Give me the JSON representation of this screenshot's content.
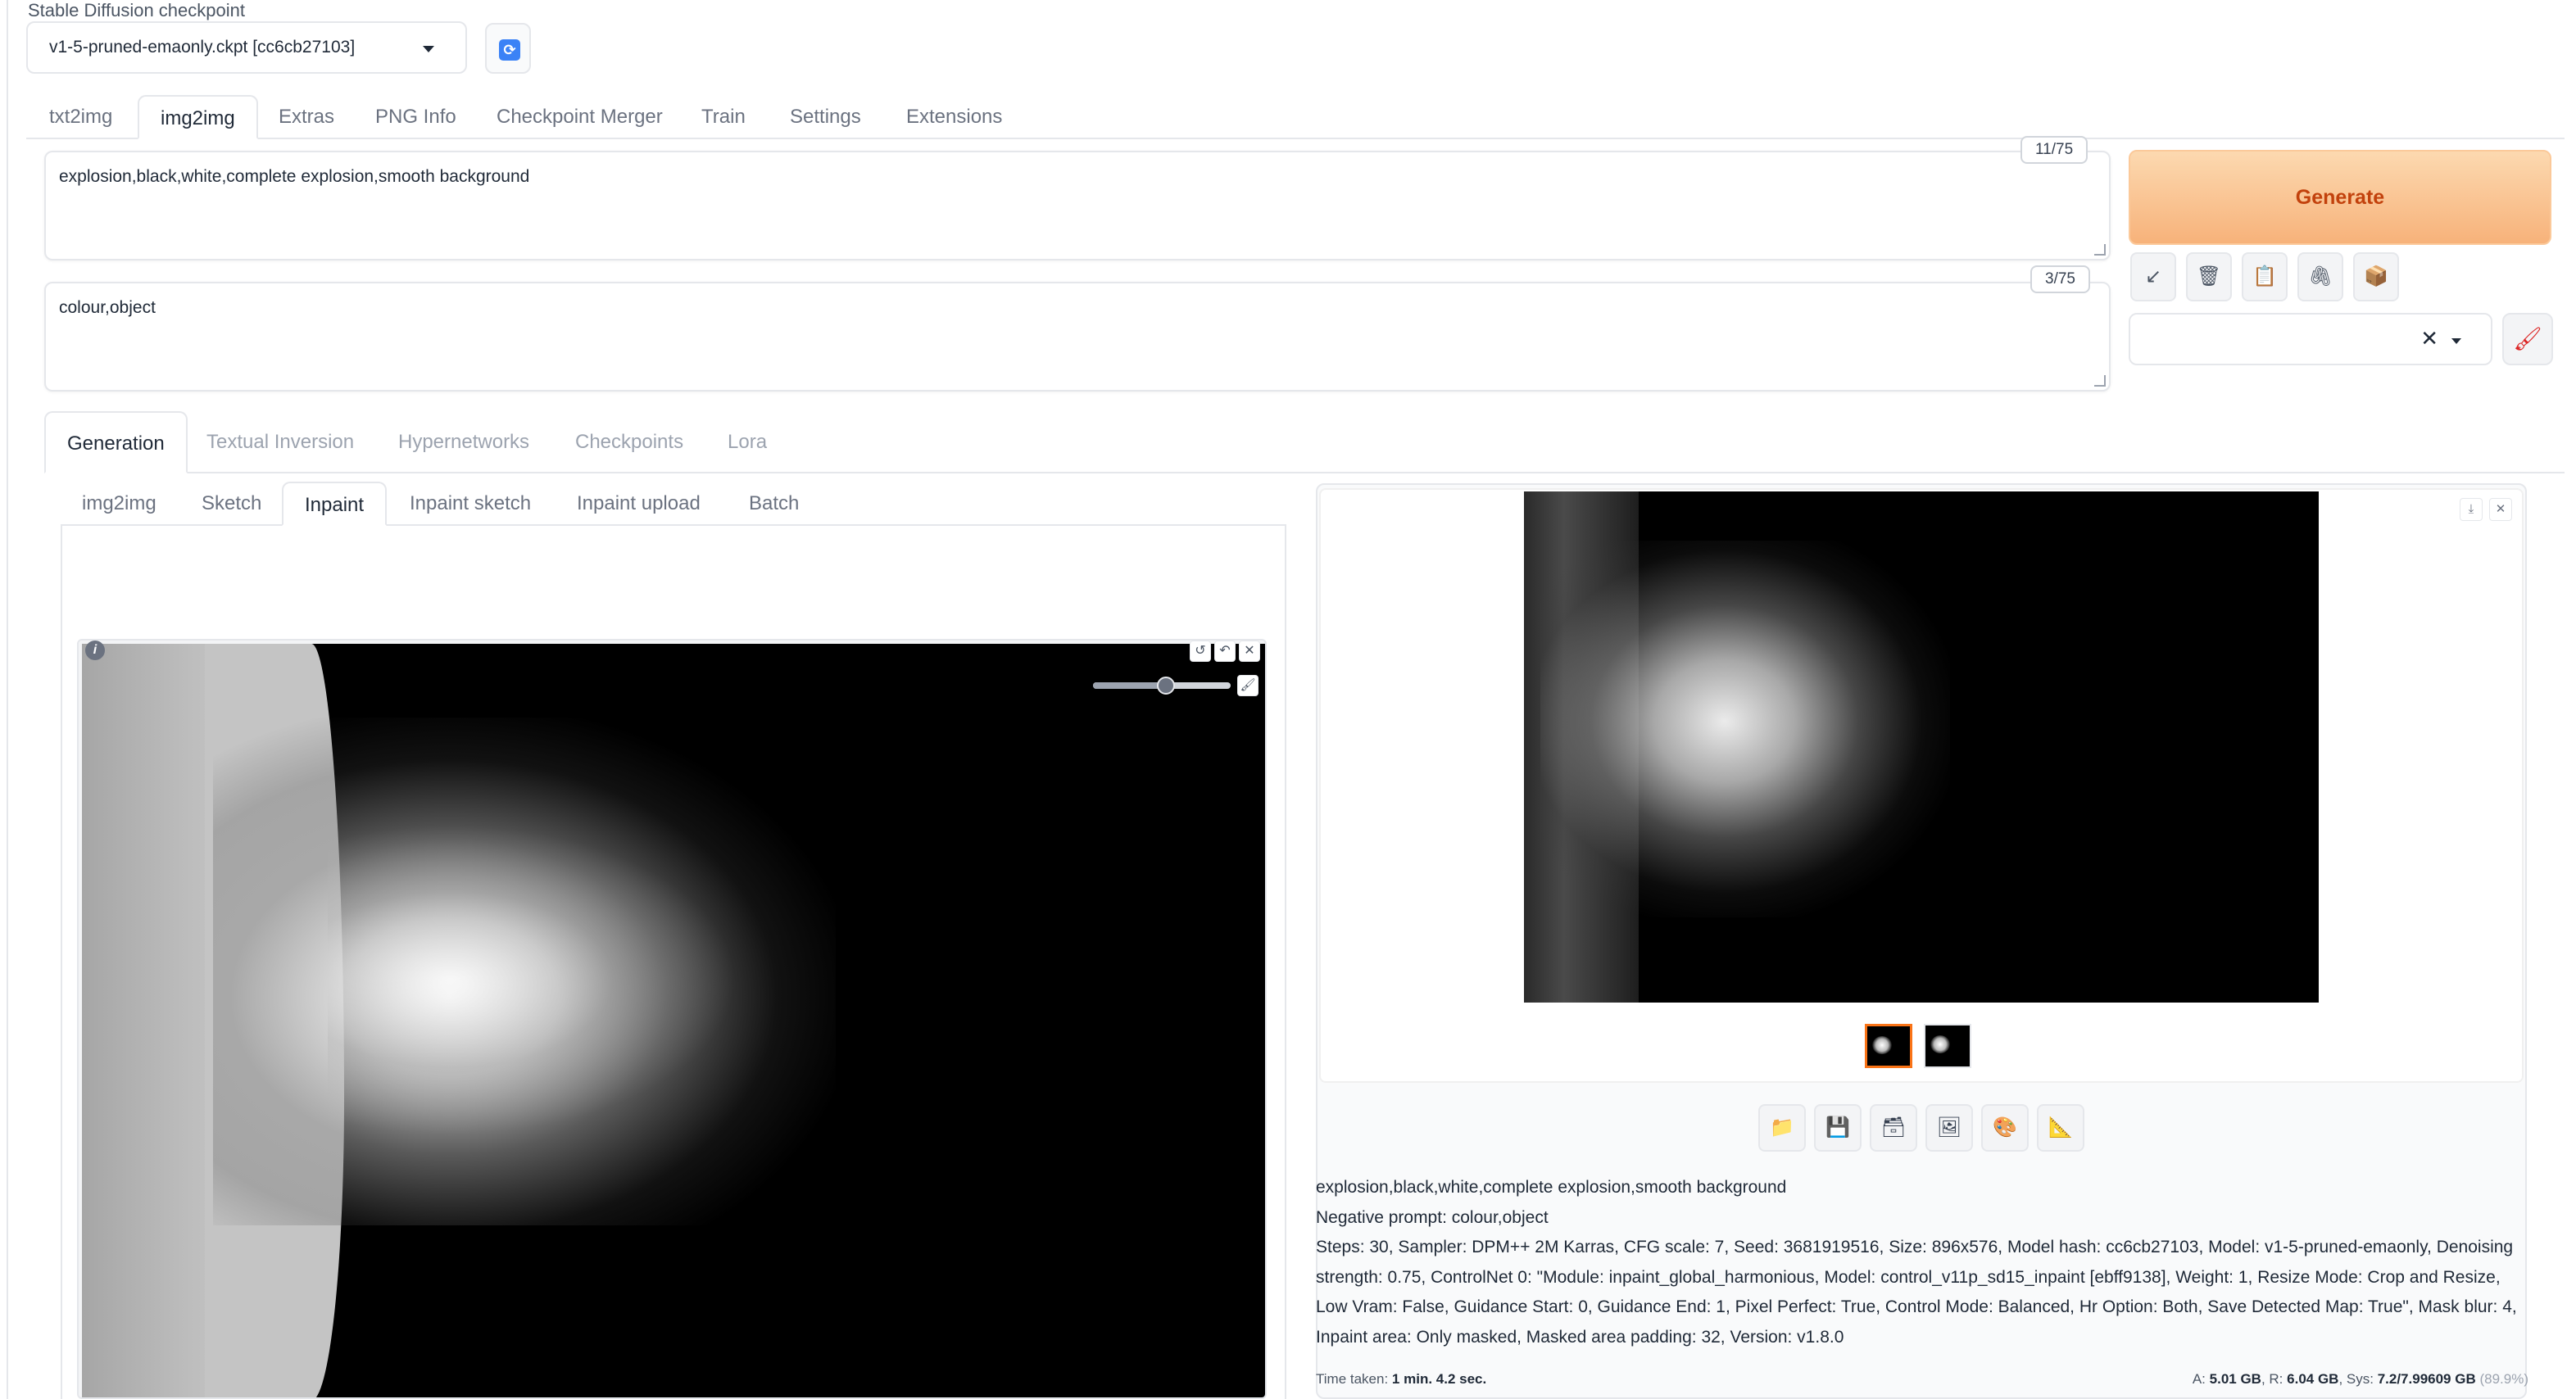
{
  "checkpoint": {
    "label": "Stable Diffusion checkpoint",
    "value": "v1-5-pruned-emaonly.ckpt [cc6cb27103]",
    "refresh_icon": "refresh-icon"
  },
  "top_tabs": [
    "txt2img",
    "img2img",
    "Extras",
    "PNG Info",
    "Checkpoint Merger",
    "Train",
    "Settings",
    "Extensions"
  ],
  "top_tabs_active": "img2img",
  "prompt": {
    "text": "explosion,black,white,complete explosion,smooth background",
    "token_count": "11/75"
  },
  "negative_prompt": {
    "text": "colour,object",
    "token_count": "3/75"
  },
  "generate": {
    "label": "Generate",
    "color_from": "#fcd9b0",
    "color_to": "#f7b27a",
    "text_color": "#c2410c"
  },
  "tool_buttons": [
    {
      "name": "read-params-icon",
      "glyph": "↙"
    },
    {
      "name": "trash-icon",
      "glyph": "🗑"
    },
    {
      "name": "clipboard-icon",
      "glyph": "📋"
    },
    {
      "name": "style-apply-icon",
      "glyph": "🖇"
    },
    {
      "name": "save-style-icon",
      "glyph": "📦"
    }
  ],
  "styles": {
    "value": "",
    "clear_glyph": "✕",
    "edit_glyph": "🖌"
  },
  "extra_tabs": [
    "Generation",
    "Textual Inversion",
    "Hypernetworks",
    "Checkpoints",
    "Lora"
  ],
  "extra_tabs_active": "Generation",
  "mode_tabs": [
    "img2img",
    "Sketch",
    "Inpaint",
    "Inpaint sketch",
    "Inpaint upload",
    "Batch"
  ],
  "mode_tabs_active": "Inpaint",
  "canvas": {
    "info_glyph": "i",
    "controls": [
      "↺",
      "↶",
      "✕"
    ],
    "brush_size_fraction": 0.53,
    "brush_color_glyph": "🖌"
  },
  "output": {
    "controls": [
      "⤓",
      "✕"
    ],
    "thumbnails": 2,
    "selected_thumbnail": 0,
    "accent": "#f97316",
    "actions": [
      {
        "name": "open-folder-icon",
        "glyph": "📁"
      },
      {
        "name": "save-icon",
        "glyph": "💾"
      },
      {
        "name": "zip-icon",
        "glyph": "🗃"
      },
      {
        "name": "send-to-img2img-icon",
        "glyph": "🖼"
      },
      {
        "name": "send-to-inpaint-icon",
        "glyph": "🎨"
      },
      {
        "name": "send-to-extras-icon",
        "glyph": "📐"
      }
    ],
    "info_lines": [
      "explosion,black,white,complete explosion,smooth background",
      "Negative prompt: colour,object",
      "Steps: 30, Sampler: DPM++ 2M Karras, CFG scale: 7, Seed: 3681919516, Size: 896x576, Model hash: cc6cb27103, Model: v1-5-pruned-emaonly, Denoising",
      "strength: 0.75, ControlNet 0: \"Module: inpaint_global_harmonious, Model: control_v11p_sd15_inpaint [ebff9138], Weight: 1, Resize Mode: Crop and Resize,",
      "Low Vram: False, Guidance Start: 0, Guidance End: 1, Pixel Perfect: True, Control Mode: Balanced, Hr Option: Both, Save Detected Map: True\", Mask blur: 4,",
      "Inpaint area: Only masked, Masked area padding: 32, Version: v1.8.0"
    ],
    "time_label": "Time taken:",
    "time_value": "1 min. 4.2 sec.",
    "vram_a_label": "A:",
    "vram_a": "5.01 GB",
    "vram_r_label": ", R:",
    "vram_r": "6.04 GB",
    "vram_sys_label": ", Sys:",
    "vram_sys": "7.2/7.99609 GB",
    "vram_pct": "(89.9%)"
  }
}
